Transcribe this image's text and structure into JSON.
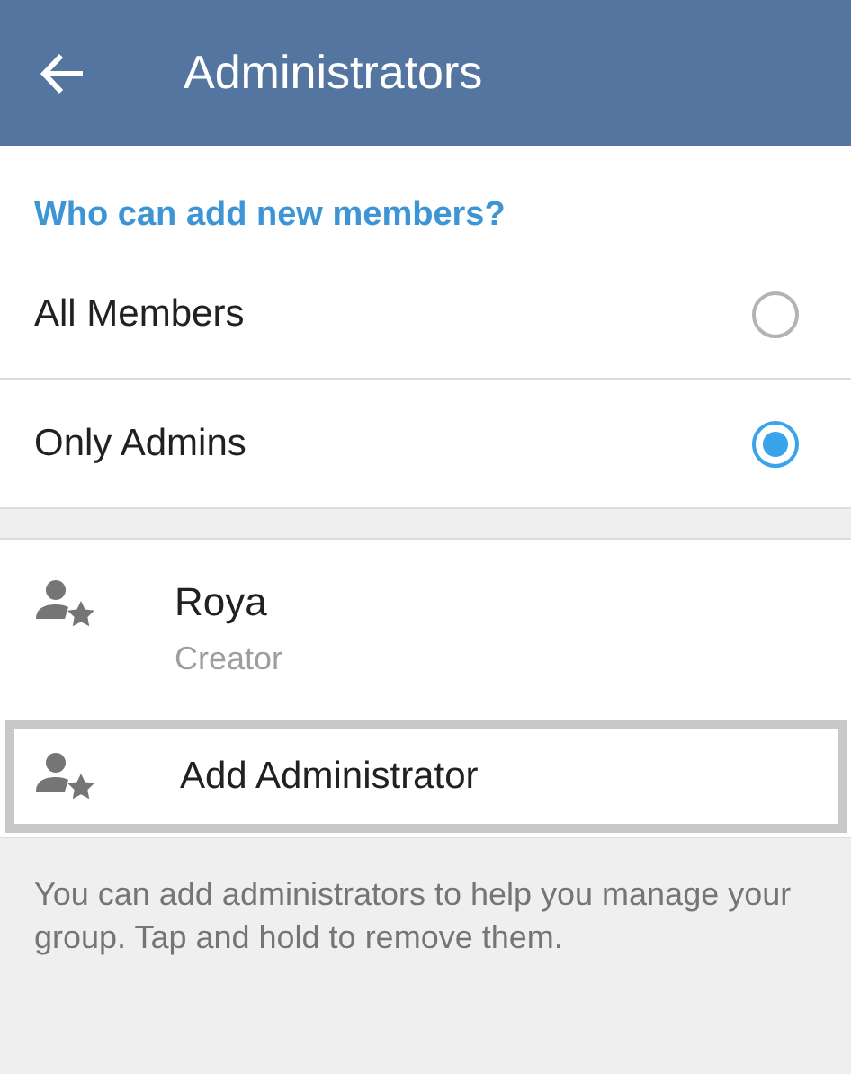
{
  "toolbar": {
    "title": "Administrators"
  },
  "permission": {
    "heading": "Who can add new members?",
    "options": [
      {
        "label": "All Members",
        "selected": false
      },
      {
        "label": "Only Admins",
        "selected": true
      }
    ]
  },
  "admins": [
    {
      "name": "Roya",
      "role": "Creator"
    }
  ],
  "add_admin": {
    "label": "Add Administrator",
    "focused": true
  },
  "hint": "You can add administrators to help you manage your group. Tap and hold to remove them."
}
